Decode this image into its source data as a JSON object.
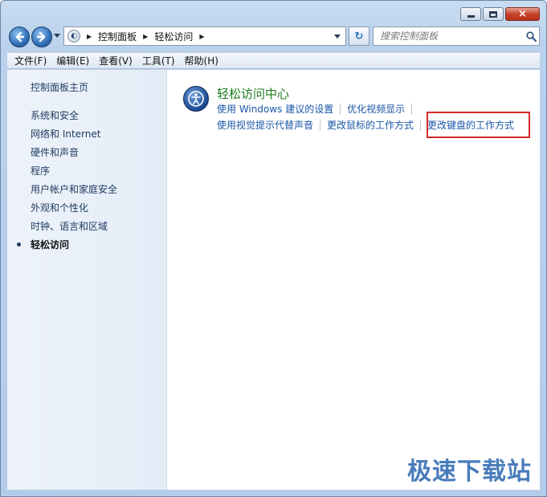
{
  "window": {
    "controls": {
      "close_symbol": "×"
    }
  },
  "nav": {
    "breadcrumbs": [
      "控制面板",
      "轻松访问"
    ],
    "search_placeholder": "搜索控制面板",
    "refresh_symbol": "↻"
  },
  "menubar": {
    "items": [
      "文件(F)",
      "编辑(E)",
      "查看(V)",
      "工具(T)",
      "帮助(H)"
    ]
  },
  "sidebar": {
    "home": "控制面板主页",
    "items": [
      "系统和安全",
      "网络和 Internet",
      "硬件和声音",
      "程序",
      "用户帐户和家庭安全",
      "外观和个性化",
      "时钟、语言和区域",
      "轻松访问"
    ],
    "active_index": 7
  },
  "main": {
    "section_title": "轻松访问中心",
    "row1": [
      "使用 Windows 建议的设置",
      "优化视频显示"
    ],
    "row2": [
      "使用视觉提示代替声音",
      "更改鼠标的工作方式",
      "更改键盘的工作方式"
    ]
  },
  "watermark": "极速下载站",
  "colors": {
    "link": "#1a56a8",
    "section_title": "#1e7a1e",
    "highlight": "#d42a2a",
    "watermark": "#2a66b0"
  },
  "icons": {
    "back": "arrow-left-icon",
    "forward": "arrow-right-icon",
    "search": "magnifier-icon",
    "section": "ease-of-access-icon"
  }
}
